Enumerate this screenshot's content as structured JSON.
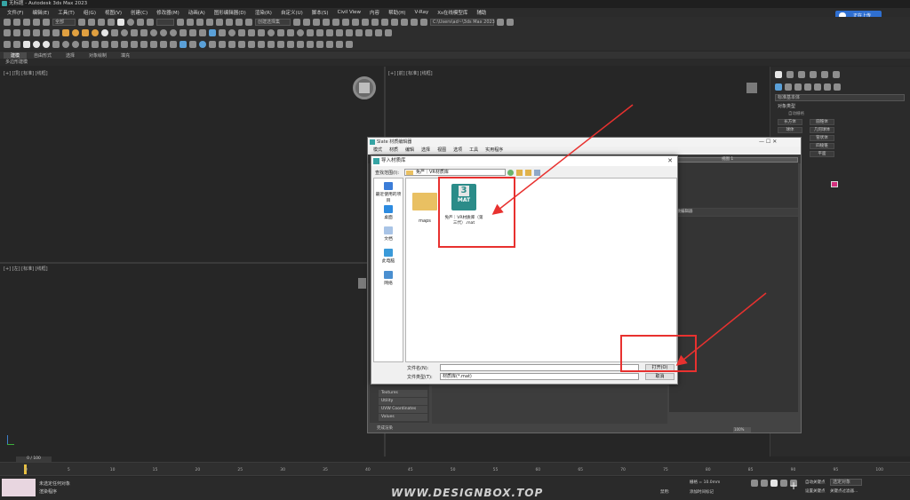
{
  "titlebar": {
    "title": "无标题 - Autodesk 3ds Max 2023"
  },
  "menu": [
    "文件(F)",
    "编辑(E)",
    "工具(T)",
    "组(G)",
    "视图(V)",
    "创建(C)",
    "修改器(M)",
    "动画(A)",
    "图形编辑器(D)",
    "渲染(R)",
    "自定义(U)",
    "脚本(S)",
    "Civil View",
    "内容",
    "帮助(H)",
    "V-Ray",
    "Xs在线模型库",
    "辅助"
  ],
  "toolbar": {
    "filter_label": "全部",
    "select_set": "创建选择集",
    "workspace": "C:\\Users\\ad~\\3ds Max 2023"
  },
  "cloud_button": "正在上传",
  "ribbon": {
    "tabs": [
      "建模",
      "自由形式",
      "选择",
      "对象绘制",
      "填充"
    ],
    "subtitle": "多边形建模"
  },
  "viewports": {
    "top_left": "[+] [顶] [标准] [线框]",
    "top_right": "[+] [前] [标准] [线框]",
    "bottom_left": "[+] [左] [标准] [线框]"
  },
  "command_panel": {
    "standard_primitives": "标准基本体",
    "object_type": "对象类型",
    "autogrid": "自动栅格",
    "buttons": [
      "长方体",
      "圆锥体",
      "球体",
      "几何球体",
      "管状体",
      "四棱锥",
      "平面"
    ]
  },
  "material_editor": {
    "title": "Slate 材质编辑器",
    "menu": [
      "模式",
      "材质",
      "编辑",
      "选择",
      "视图",
      "选项",
      "工具",
      "实用程序"
    ],
    "view_label": "视图 1",
    "param_editor": "参数编辑器",
    "left_items": [
      "Textures",
      "Utility",
      "UVW Coordinates",
      "Values"
    ],
    "zoom": "100%",
    "status": "完成渲染"
  },
  "dialog": {
    "title": "导入材质库",
    "look_in_label": "查找范围(I):",
    "look_in_value": "免严｜VR材质库",
    "places": [
      "最近使用的项目",
      "桌面",
      "文档",
      "此电脑",
      "网络"
    ],
    "files": [
      {
        "name": "maps",
        "type": "folder"
      },
      {
        "name": "免严｜VR材质库（第三代）.mat",
        "type": "mat",
        "badge_top": "3",
        "badge_bottom": "MAT"
      }
    ],
    "filename_label": "文件名(N):",
    "filetype_label": "文件类型(T):",
    "filetype_value": "材质库(*.mat)",
    "open_button": "打开(O)",
    "cancel_button": "取消"
  },
  "timeline": {
    "frame_display": "0 / 100",
    "ticks": [
      "0",
      "5",
      "10",
      "15",
      "20",
      "25",
      "30",
      "35",
      "40",
      "45",
      "50",
      "55",
      "60",
      "65",
      "70",
      "75",
      "80",
      "85",
      "90",
      "95",
      "100"
    ]
  },
  "status": {
    "line1": "未选定任何对象",
    "line2": "渲染程序",
    "grid": "栅格 = 10.0mm",
    "add_time_tag": "添加时间标记",
    "auto_key": "自动关键点",
    "set_key": "设置关键点",
    "selected_object": "选定对象",
    "key_filter": "关键点过滤器...",
    "enabled": "禁用:"
  },
  "watermark": "WWW.DESIGNBOX.TOP",
  "colors": {
    "accent": "#5aa0d8",
    "annotation_red": "#e8312f",
    "mat_badge": "#2b8c89"
  }
}
